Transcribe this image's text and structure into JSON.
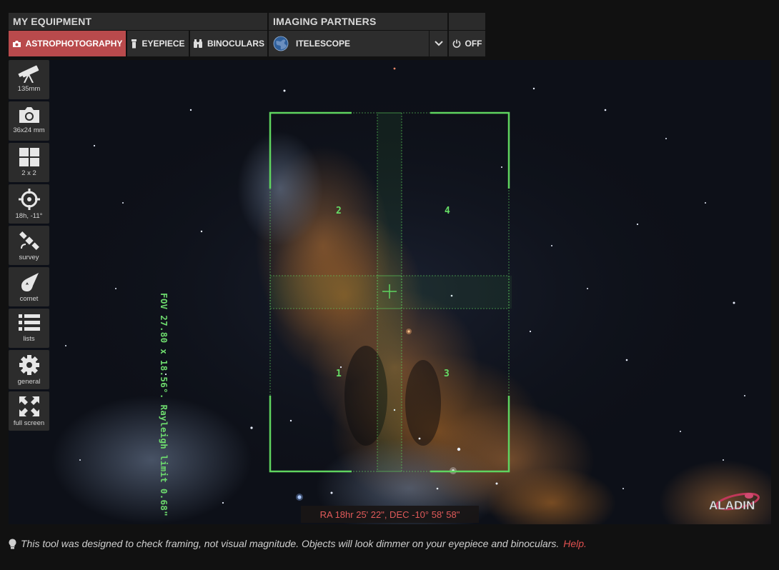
{
  "toolbar": {
    "my_equipment_label": "MY EQUIPMENT",
    "imaging_partners_label": "IMAGING PARTNERS",
    "astrophotography_label": "ASTROPHOTOGRAPHY",
    "eyepiece_label": "EYEPIECE",
    "binoculars_label": "BINOCULARS",
    "partner_label": "ITELESCOPE",
    "off_label": "OFF",
    "active_tab": "astrophotography"
  },
  "sidebar": {
    "items": [
      {
        "id": "focal-length",
        "icon": "telescope-icon",
        "label": "135mm"
      },
      {
        "id": "sensor",
        "icon": "camera-icon",
        "label": "36x24 mm"
      },
      {
        "id": "mosaic",
        "icon": "grid-icon",
        "label": "2 x 2"
      },
      {
        "id": "target",
        "icon": "crosshair-icon",
        "label": "18h, -11°"
      },
      {
        "id": "survey",
        "icon": "satellite-icon",
        "label": "survey"
      },
      {
        "id": "comet",
        "icon": "comet-icon",
        "label": "comet"
      },
      {
        "id": "lists",
        "icon": "list-icon",
        "label": "lists"
      },
      {
        "id": "general",
        "icon": "gear-icon",
        "label": "general"
      },
      {
        "id": "fullscreen",
        "icon": "expand-icon",
        "label": "full screen"
      }
    ]
  },
  "viewer": {
    "fov_text": "FOV 27.80 x 18.56°. Rayleigh limit 0.68\"",
    "quadrants": [
      "1",
      "2",
      "3",
      "4"
    ],
    "coordinates": "RA 18hr 25' 22\", DEC -10° 58' 58\"",
    "logo_text": "ALADIN",
    "frame_color": "#5fd45f",
    "coord_color": "#e05a5a"
  },
  "footer": {
    "note": "This tool was designed to check framing, not visual magnitude. Objects will look dimmer on your eyepiece and binoculars.",
    "help_link": "Help."
  },
  "colors": {
    "accent": "#b94a4c",
    "panel": "#2d2d2d",
    "background": "#111111"
  }
}
